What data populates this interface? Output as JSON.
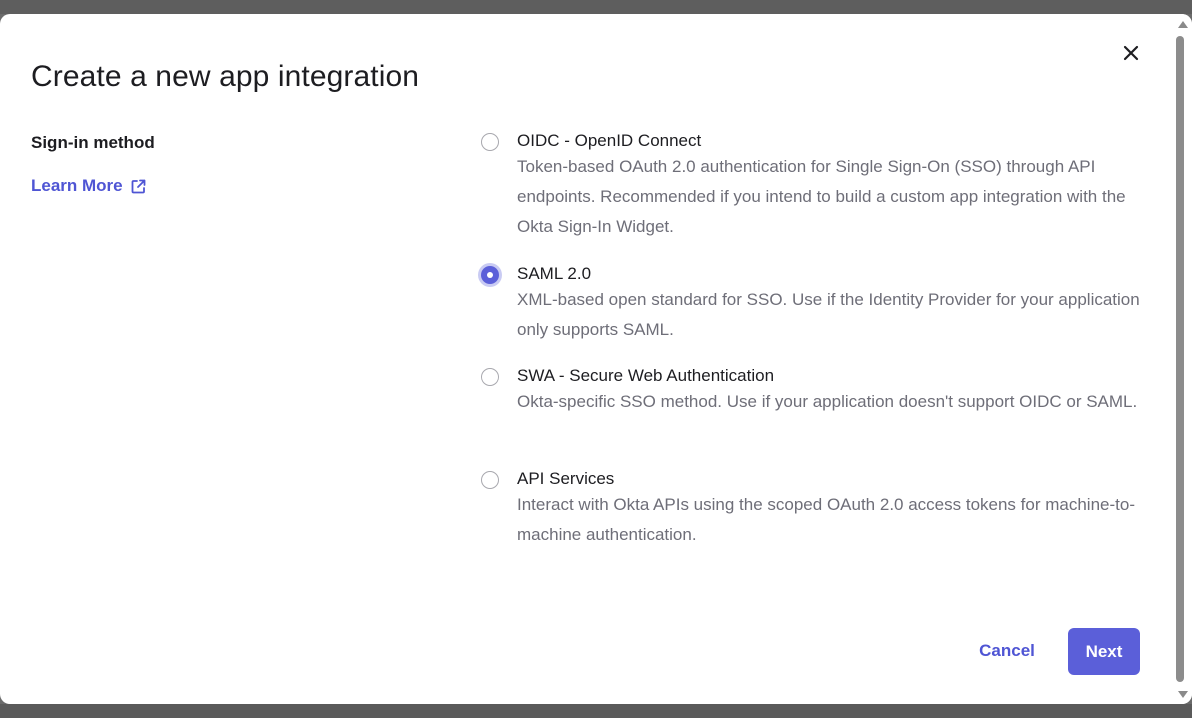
{
  "dialog": {
    "title": "Create a new app integration",
    "close_label": "Close"
  },
  "sidebar": {
    "section_label": "Sign-in method",
    "learn_more": "Learn More"
  },
  "options": [
    {
      "label": "OIDC - OpenID Connect",
      "description": "Token-based OAuth 2.0 authentication for Single Sign-On (SSO) through API endpoints. Recommended if you intend to build a custom app integration with the Okta Sign-In Widget.",
      "selected": false
    },
    {
      "label": "SAML 2.0",
      "description": "XML-based open standard for SSO. Use if the Identity Provider for your application only supports SAML.",
      "selected": true
    },
    {
      "label": "SWA - Secure Web Authentication",
      "description": "Okta-specific SSO method. Use if your application doesn't support OIDC or SAML.",
      "selected": false
    },
    {
      "label": "API Services",
      "description": "Interact with Okta APIs using the scoped OAuth 2.0 access tokens for machine-to-machine authentication.",
      "selected": false
    }
  ],
  "footer": {
    "cancel_label": "Cancel",
    "next_label": "Next"
  },
  "colors": {
    "accent": "#5b5fd9",
    "link": "#4f55d4",
    "text_primary": "#1d1d21",
    "text_secondary": "#6e6e78"
  },
  "icons": {
    "close": "close-icon",
    "external_link": "external-link-icon"
  }
}
